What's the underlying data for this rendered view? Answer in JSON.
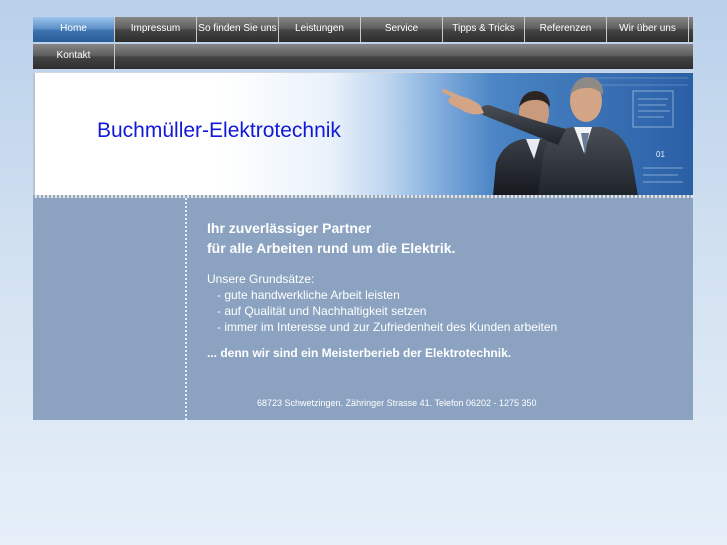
{
  "nav": {
    "row1": [
      {
        "label": "Home",
        "active": true
      },
      {
        "label": "Impressum"
      },
      {
        "label": "So finden Sie uns"
      },
      {
        "label": "Leistungen"
      },
      {
        "label": "Service"
      },
      {
        "label": "Tipps & Tricks"
      },
      {
        "label": "Referenzen"
      },
      {
        "label": "Wir über uns"
      }
    ],
    "row2": [
      {
        "label": "Kontakt"
      }
    ]
  },
  "header": {
    "company_name": "Buchmüller-Elektrotechnik",
    "image_desc_icon": "two-businessmen-pointing-image",
    "image_number": "01"
  },
  "content": {
    "headline_line1": "Ihr zuverlässiger Partner",
    "headline_line2": "für alle Arbeiten rund um die Elektrik.",
    "principles_title": "Unsere Grundsätze:",
    "principles": [
      "- gute handwerkliche Arbeit leisten",
      "- auf Qualität und Nachhaltigkeit setzen",
      "- immer im Interesse und zur Zufriedenheit des Kunden arbeiten"
    ],
    "closing": "... denn wir sind ein Meisterberieb der Elektrotechnik.",
    "footer_address": "68723 Schwetzingen. Zähringer Strasse 41. Telefon 06202 - 1275 350"
  },
  "colors": {
    "company_name": "#1218d8",
    "content_bg": "#8ba3c1",
    "nav_active": "#3c72b0"
  }
}
